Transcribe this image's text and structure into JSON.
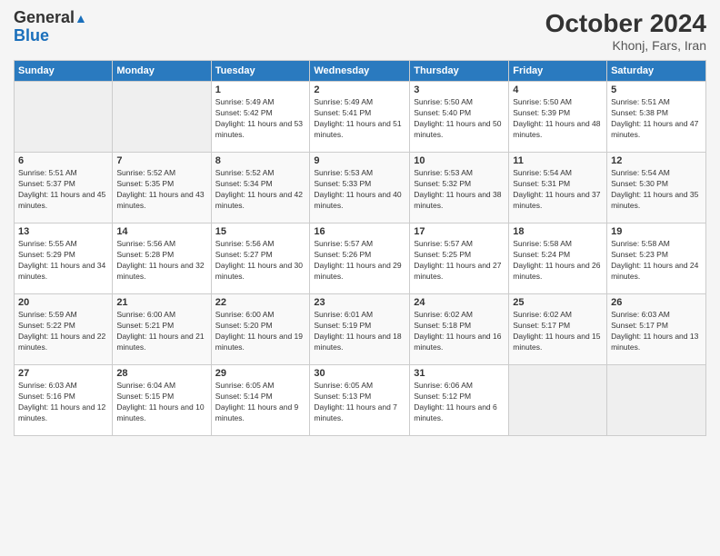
{
  "logo": {
    "line1": "General",
    "line2": "Blue"
  },
  "title": "October 2024",
  "location": "Khonj, Fars, Iran",
  "days_header": [
    "Sunday",
    "Monday",
    "Tuesday",
    "Wednesday",
    "Thursday",
    "Friday",
    "Saturday"
  ],
  "weeks": [
    [
      {
        "day": "",
        "info": ""
      },
      {
        "day": "",
        "info": ""
      },
      {
        "day": "1",
        "info": "Sunrise: 5:49 AM\nSunset: 5:42 PM\nDaylight: 11 hours and 53 minutes."
      },
      {
        "day": "2",
        "info": "Sunrise: 5:49 AM\nSunset: 5:41 PM\nDaylight: 11 hours and 51 minutes."
      },
      {
        "day": "3",
        "info": "Sunrise: 5:50 AM\nSunset: 5:40 PM\nDaylight: 11 hours and 50 minutes."
      },
      {
        "day": "4",
        "info": "Sunrise: 5:50 AM\nSunset: 5:39 PM\nDaylight: 11 hours and 48 minutes."
      },
      {
        "day": "5",
        "info": "Sunrise: 5:51 AM\nSunset: 5:38 PM\nDaylight: 11 hours and 47 minutes."
      }
    ],
    [
      {
        "day": "6",
        "info": "Sunrise: 5:51 AM\nSunset: 5:37 PM\nDaylight: 11 hours and 45 minutes."
      },
      {
        "day": "7",
        "info": "Sunrise: 5:52 AM\nSunset: 5:35 PM\nDaylight: 11 hours and 43 minutes."
      },
      {
        "day": "8",
        "info": "Sunrise: 5:52 AM\nSunset: 5:34 PM\nDaylight: 11 hours and 42 minutes."
      },
      {
        "day": "9",
        "info": "Sunrise: 5:53 AM\nSunset: 5:33 PM\nDaylight: 11 hours and 40 minutes."
      },
      {
        "day": "10",
        "info": "Sunrise: 5:53 AM\nSunset: 5:32 PM\nDaylight: 11 hours and 38 minutes."
      },
      {
        "day": "11",
        "info": "Sunrise: 5:54 AM\nSunset: 5:31 PM\nDaylight: 11 hours and 37 minutes."
      },
      {
        "day": "12",
        "info": "Sunrise: 5:54 AM\nSunset: 5:30 PM\nDaylight: 11 hours and 35 minutes."
      }
    ],
    [
      {
        "day": "13",
        "info": "Sunrise: 5:55 AM\nSunset: 5:29 PM\nDaylight: 11 hours and 34 minutes."
      },
      {
        "day": "14",
        "info": "Sunrise: 5:56 AM\nSunset: 5:28 PM\nDaylight: 11 hours and 32 minutes."
      },
      {
        "day": "15",
        "info": "Sunrise: 5:56 AM\nSunset: 5:27 PM\nDaylight: 11 hours and 30 minutes."
      },
      {
        "day": "16",
        "info": "Sunrise: 5:57 AM\nSunset: 5:26 PM\nDaylight: 11 hours and 29 minutes."
      },
      {
        "day": "17",
        "info": "Sunrise: 5:57 AM\nSunset: 5:25 PM\nDaylight: 11 hours and 27 minutes."
      },
      {
        "day": "18",
        "info": "Sunrise: 5:58 AM\nSunset: 5:24 PM\nDaylight: 11 hours and 26 minutes."
      },
      {
        "day": "19",
        "info": "Sunrise: 5:58 AM\nSunset: 5:23 PM\nDaylight: 11 hours and 24 minutes."
      }
    ],
    [
      {
        "day": "20",
        "info": "Sunrise: 5:59 AM\nSunset: 5:22 PM\nDaylight: 11 hours and 22 minutes."
      },
      {
        "day": "21",
        "info": "Sunrise: 6:00 AM\nSunset: 5:21 PM\nDaylight: 11 hours and 21 minutes."
      },
      {
        "day": "22",
        "info": "Sunrise: 6:00 AM\nSunset: 5:20 PM\nDaylight: 11 hours and 19 minutes."
      },
      {
        "day": "23",
        "info": "Sunrise: 6:01 AM\nSunset: 5:19 PM\nDaylight: 11 hours and 18 minutes."
      },
      {
        "day": "24",
        "info": "Sunrise: 6:02 AM\nSunset: 5:18 PM\nDaylight: 11 hours and 16 minutes."
      },
      {
        "day": "25",
        "info": "Sunrise: 6:02 AM\nSunset: 5:17 PM\nDaylight: 11 hours and 15 minutes."
      },
      {
        "day": "26",
        "info": "Sunrise: 6:03 AM\nSunset: 5:17 PM\nDaylight: 11 hours and 13 minutes."
      }
    ],
    [
      {
        "day": "27",
        "info": "Sunrise: 6:03 AM\nSunset: 5:16 PM\nDaylight: 11 hours and 12 minutes."
      },
      {
        "day": "28",
        "info": "Sunrise: 6:04 AM\nSunset: 5:15 PM\nDaylight: 11 hours and 10 minutes."
      },
      {
        "day": "29",
        "info": "Sunrise: 6:05 AM\nSunset: 5:14 PM\nDaylight: 11 hours and 9 minutes."
      },
      {
        "day": "30",
        "info": "Sunrise: 6:05 AM\nSunset: 5:13 PM\nDaylight: 11 hours and 7 minutes."
      },
      {
        "day": "31",
        "info": "Sunrise: 6:06 AM\nSunset: 5:12 PM\nDaylight: 11 hours and 6 minutes."
      },
      {
        "day": "",
        "info": ""
      },
      {
        "day": "",
        "info": ""
      }
    ]
  ]
}
